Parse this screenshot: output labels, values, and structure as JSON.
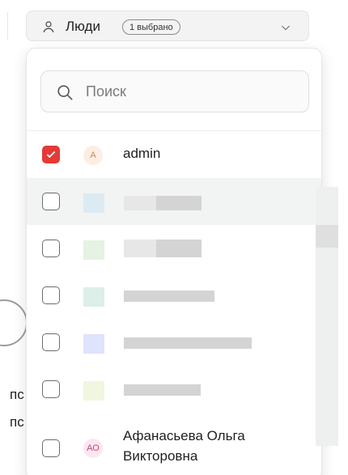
{
  "header": {
    "icon": "person-icon",
    "label": "Люди",
    "selected_badge": "1 выбрано",
    "chevron": "chevron-down-icon"
  },
  "search": {
    "icon": "search-icon",
    "placeholder": "Поиск"
  },
  "people": [
    {
      "avatar": "A",
      "name": "admin",
      "checked": true
    },
    {
      "avatar": "",
      "name": "",
      "checked": false
    },
    {
      "avatar": "",
      "name": "",
      "checked": false
    },
    {
      "avatar": "",
      "name": "",
      "checked": false
    },
    {
      "avatar": "",
      "name": "",
      "checked": false
    },
    {
      "avatar": "",
      "name": "",
      "checked": false
    },
    {
      "avatar": "АО",
      "name_line1": "Афанасьева Ольга",
      "name_line2": "Викторовна",
      "checked": false
    }
  ],
  "background": {
    "text1": "пс",
    "text2": "пс"
  },
  "colors": {
    "check_accent": "#e33b36",
    "hover_row": "#f1f4f3",
    "badge_border": "#8a8a8a"
  }
}
